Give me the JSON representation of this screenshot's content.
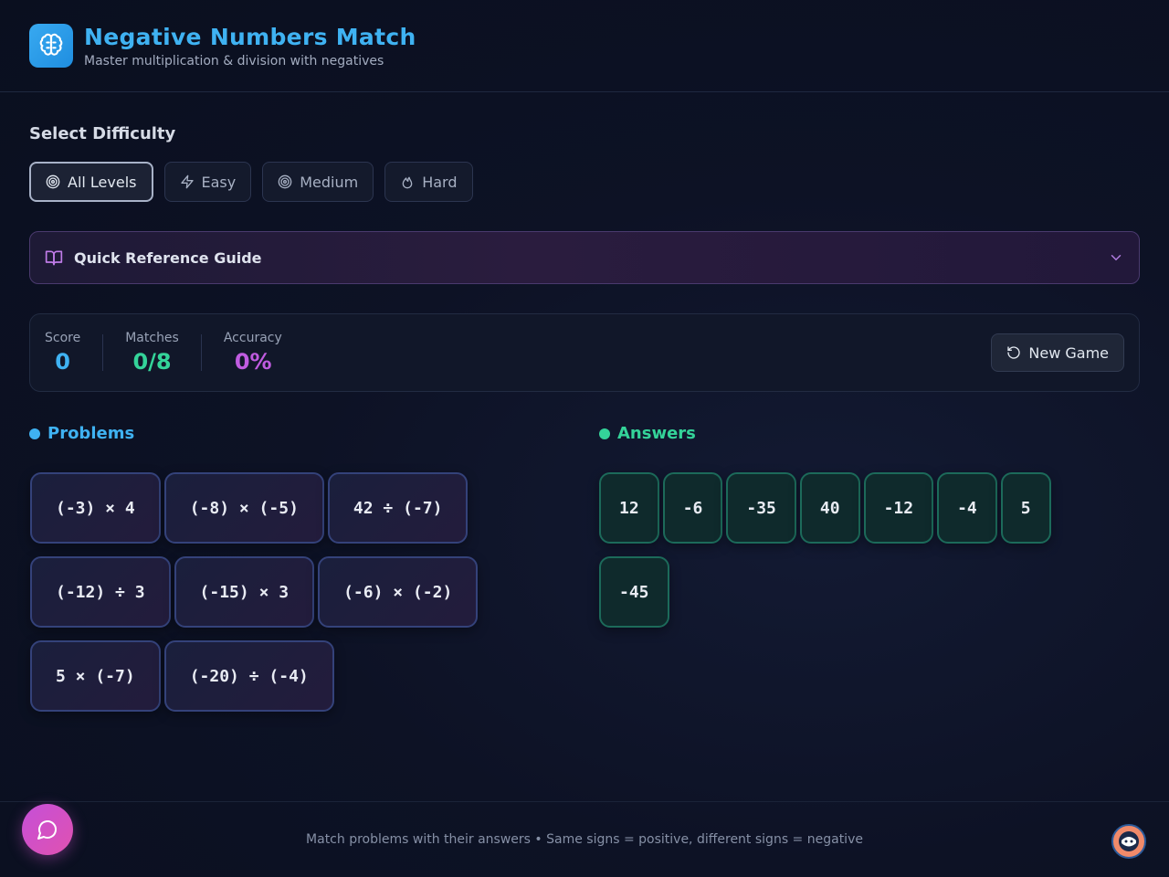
{
  "header": {
    "title": "Negative Numbers Match",
    "subtitle": "Master multiplication & division with negatives",
    "logo_icon": "brain-icon"
  },
  "difficulty": {
    "label": "Select Difficulty",
    "options": [
      {
        "label": "All Levels",
        "icon": "target-icon",
        "active": true
      },
      {
        "label": "Easy",
        "icon": "lightning-icon",
        "active": false
      },
      {
        "label": "Medium",
        "icon": "target-icon",
        "active": false
      },
      {
        "label": "Hard",
        "icon": "flame-icon",
        "active": false
      }
    ]
  },
  "guide": {
    "label": "Quick Reference Guide"
  },
  "stats": {
    "score_label": "Score",
    "score_value": "0",
    "matches_label": "Matches",
    "matches_value": "0/8",
    "accuracy_label": "Accuracy",
    "accuracy_value": "0%",
    "new_game_label": "New Game"
  },
  "problems": {
    "heading": "Problems",
    "items": [
      "(-3) × 4",
      "(-8) × (-5)",
      "42 ÷ (-7)",
      "(-12) ÷ 3",
      "(-15) × 3",
      "(-6) × (-2)",
      "5 × (-7)",
      "(-20) ÷ (-4)"
    ]
  },
  "answers": {
    "heading": "Answers",
    "items": [
      "12",
      "-6",
      "-35",
      "40",
      "-12",
      "-4",
      "5",
      "-45"
    ]
  },
  "footer": {
    "text": "Match problems with their answers • Same signs = positive, different signs = negative"
  },
  "colors": {
    "accent_blue": "#3fb2f2",
    "accent_green": "#34d399",
    "accent_purple": "#c05ce0"
  }
}
